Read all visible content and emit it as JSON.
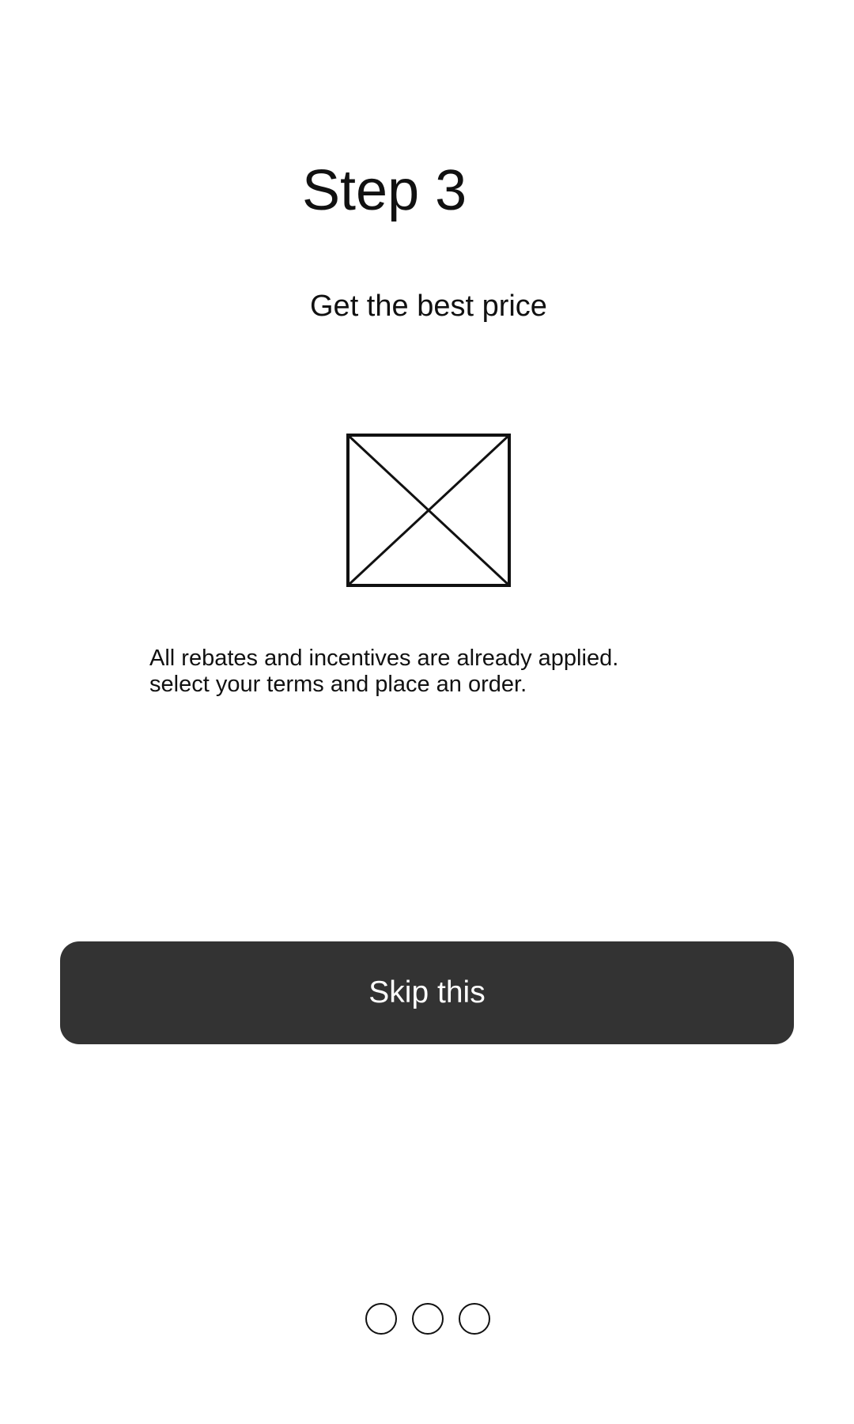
{
  "onboarding": {
    "step_title": "Step 3",
    "subtitle": "Get the best price",
    "image_icon": "image-placeholder-icon",
    "description_lines": [
      "All rebates and incentives are already applied.",
      "select your terms and place an order."
    ],
    "skip_label": "Skip this",
    "pager": {
      "total": 3
    }
  },
  "colors": {
    "background": "#ffffff",
    "text": "#111111",
    "button_background": "#333333",
    "button_text": "#ffffff"
  }
}
